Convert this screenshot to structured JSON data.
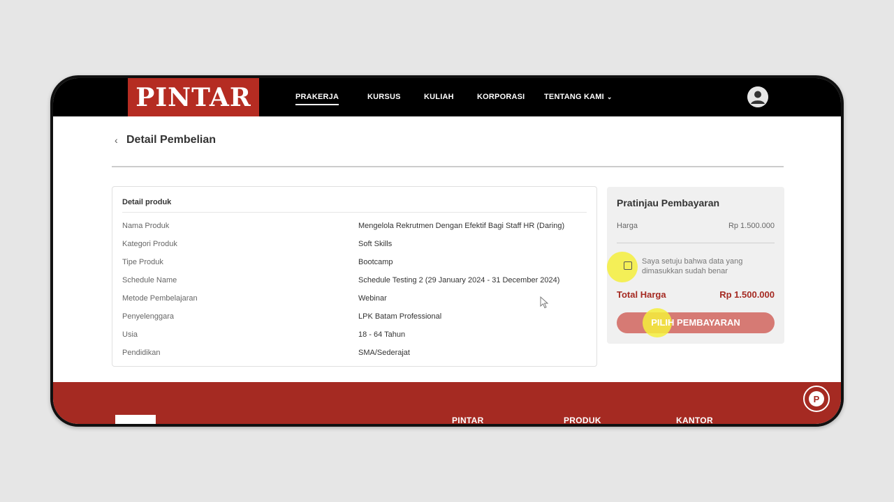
{
  "brand": {
    "logo_text": "PINTAR",
    "accent": "#a52a22"
  },
  "nav": {
    "items": [
      {
        "label": "PRAKERJA",
        "active": true
      },
      {
        "label": "KURSUS"
      },
      {
        "label": "KULIAH"
      },
      {
        "label": "KORPORASI"
      },
      {
        "label": "TENTANG KAMI"
      }
    ],
    "dropdown_icon": "chevron-down-icon",
    "profile_icon": "user-avatar-icon"
  },
  "page": {
    "title": "Detail Pembelian",
    "back_icon": "chevron-left-icon"
  },
  "product": {
    "heading": "Detail produk",
    "rows": [
      {
        "label": "Nama Produk",
        "value": "Mengelola Rekrutmen Dengan Efektif Bagi Staff HR (Daring)"
      },
      {
        "label": "Kategori Produk",
        "value": "Soft Skills"
      },
      {
        "label": "Tipe Produk",
        "value": "Bootcamp"
      },
      {
        "label": "Schedule Name",
        "value": "Schedule Testing 2 (29 January 2024 - 31 December 2024)"
      },
      {
        "label": "Metode Pembelajaran",
        "value": "Webinar"
      },
      {
        "label": "Penyelenggara",
        "value": "LPK Batam Professional"
      },
      {
        "label": "Usia",
        "value": "18 - 64 Tahun"
      },
      {
        "label": "Pendidikan",
        "value": "SMA/Sederajat"
      }
    ]
  },
  "payment": {
    "title": "Pratinjau Pembayaran",
    "price_label": "Harga",
    "price_value": "Rp 1.500.000",
    "agree_text": "Saya setuju bahwa data yang dimasukkan sudah benar",
    "agree_checked": false,
    "total_label": "Total Harga",
    "total_value": "Rp 1.500.000",
    "button_label": "PILIH PEMBAYARAN"
  },
  "footer": {
    "columns": [
      "PINTAR",
      "PRODUK",
      "KANTOR"
    ],
    "chat_icon": "chat-support-icon",
    "chat_letter": "P"
  }
}
